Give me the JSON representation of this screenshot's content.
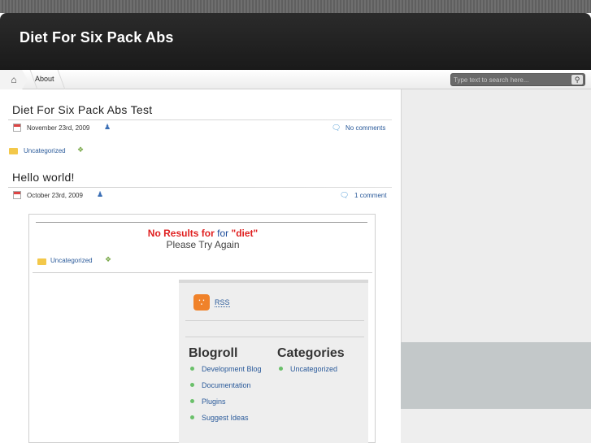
{
  "site": {
    "title": "Diet For Six Pack Abs"
  },
  "nav": {
    "about_label": "About"
  },
  "search": {
    "placeholder": "Type text to search here..."
  },
  "posts": [
    {
      "title": "Diet For Six Pack Abs Test",
      "date": "November 23rd, 2009",
      "comments": "No comments",
      "category": "Uncategorized"
    },
    {
      "title": "Hello world!",
      "date": "October 23rd, 2009",
      "comments": "1 comment"
    }
  ],
  "embed": {
    "no_results_prefix": "No Results for",
    "no_results_for": "for",
    "query": "\"diet\"",
    "try_again": "Please Try Again",
    "category": "Uncategorized",
    "rss_label": "RSS",
    "blogroll_title": "Blogroll",
    "categories_title": "Categories",
    "blogroll_items": [
      "Development Blog",
      "Documentation",
      "Plugins",
      "Suggest Ideas"
    ],
    "category_items": [
      "Uncategorized"
    ]
  },
  "colors": {
    "header": "#1f1f1f",
    "link": "#2a5a9a",
    "no_results_red": "#e02020",
    "sidebar_band": "#c3c8c9"
  }
}
